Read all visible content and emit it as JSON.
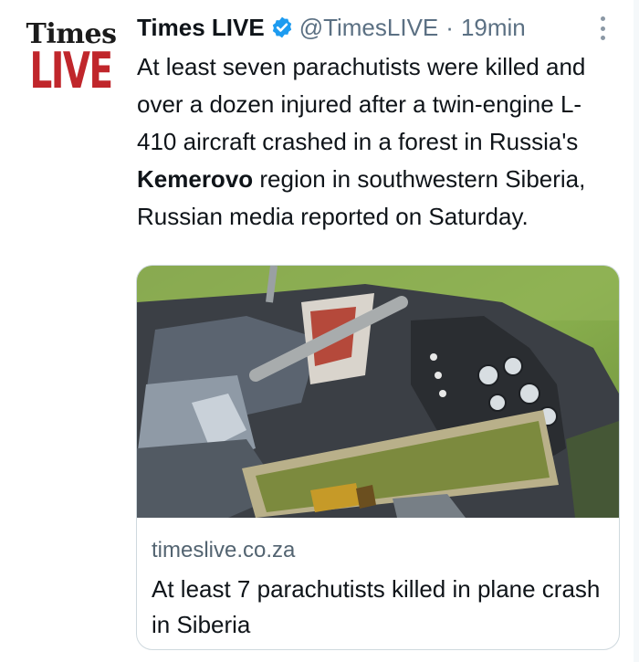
{
  "author": {
    "avatar_line1": "Times",
    "avatar_line2": "LIVE",
    "name": "Times LIVE",
    "verified_icon": "verified-badge-icon",
    "handle": "@TimesLIVE",
    "separator": "·",
    "time": "19min"
  },
  "tweet": {
    "text_before": "At least seven parachutists were killed and over a dozen injured after a twin-engine L-410 aircraft crashed in a forest in Russia's ",
    "text_bold": "Kemerovo",
    "text_after": " region in southwestern Siberia, Russian media reported on Saturday."
  },
  "card": {
    "image_desc": "wreckage-photo",
    "domain": "timeslive.co.za",
    "title": "At least 7 parachutists killed in plane crash in Siberia"
  },
  "menu": {
    "icon": "more-vertical-icon"
  },
  "colors": {
    "brand_red": "#c0262b",
    "verified_blue": "#1d9bf0",
    "secondary_text": "#5b7083"
  }
}
